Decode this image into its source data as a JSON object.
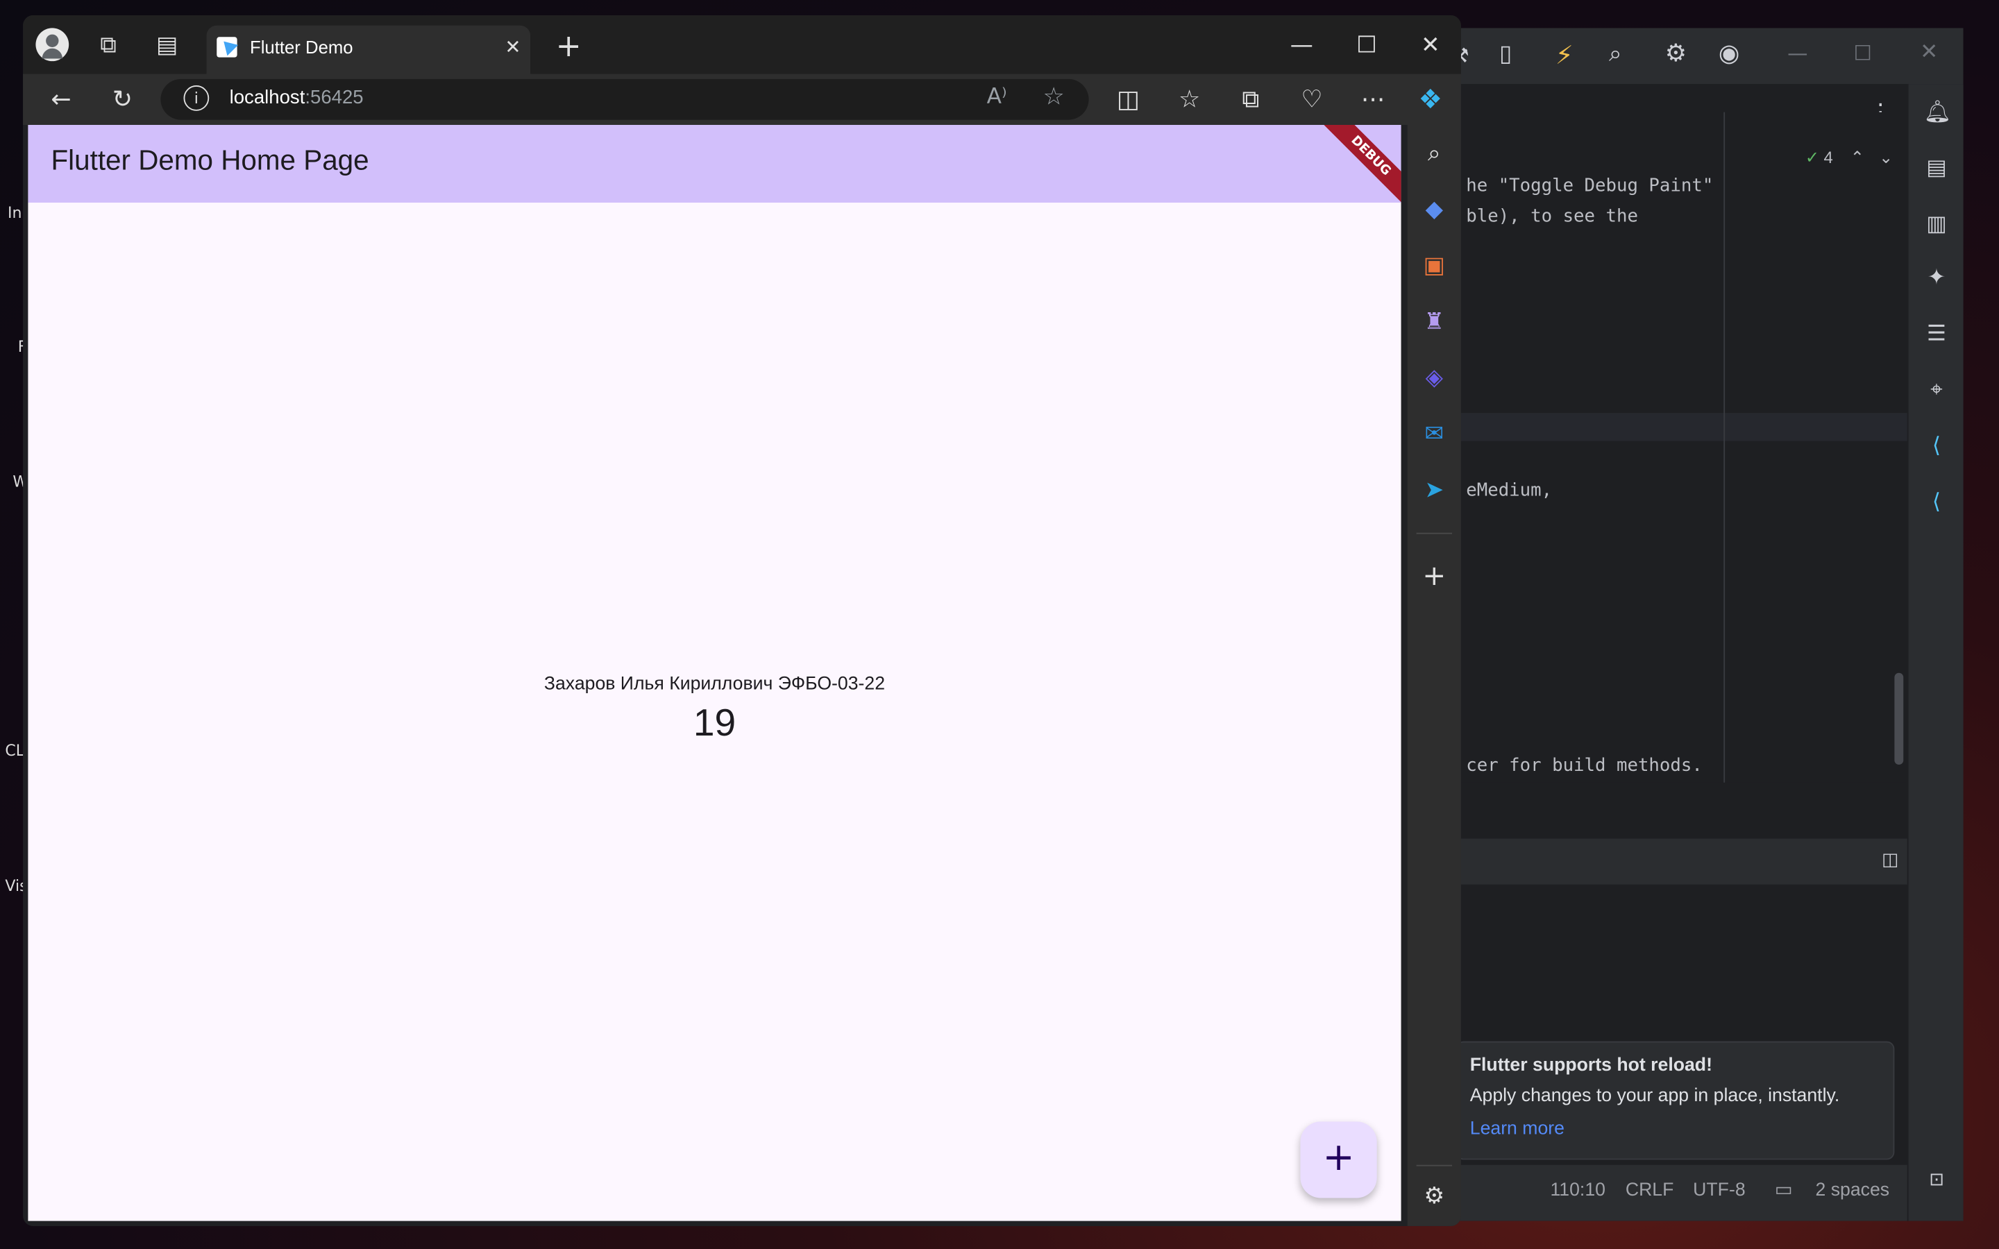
{
  "browser": {
    "tab_title": "Flutter Demo",
    "url_host": "localhost",
    "url_port": ":56425"
  },
  "app": {
    "appbar_title": "Flutter Demo Home Page",
    "debug_banner": "DEBUG",
    "caption": "Захаров Илья Кириллович ЭФБО-03-22",
    "counter": "19",
    "fab_icon": "plus-icon"
  },
  "ide": {
    "code_lines": [
      "he \"Toggle Debug Paint\"",
      "ble), to see the",
      "eMedium,",
      "cer for build methods."
    ],
    "inspection_count": "4",
    "notification": {
      "title": "Flutter supports hot reload!",
      "body": "Apply changes to your app in place, instantly.",
      "link": "Learn more"
    },
    "status": {
      "position": "110:10",
      "line_sep": "CRLF",
      "encoding": "UTF-8",
      "indent": "2 spaces"
    }
  },
  "desktop": {
    "edge_labels": [
      "In",
      "F",
      "W",
      "CL",
      "Vis"
    ]
  },
  "colors": {
    "appbar": "#d2bffb",
    "page_bg": "#fdf7ff",
    "fab": "#eaddff",
    "debug_banner": "#a31a2b",
    "link": "#548af7"
  }
}
